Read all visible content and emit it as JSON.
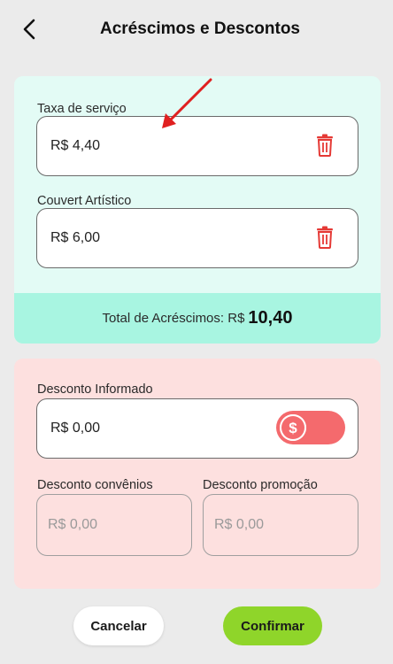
{
  "header": {
    "title": "Acréscimos e Descontos"
  },
  "acrescimos": {
    "taxa_label": "Taxa de serviço",
    "taxa_value": "R$ 4,40",
    "couvert_label": "Couvert Artístico",
    "couvert_value": "R$ 6,00",
    "total_label": "Total de Acréscimos: R$",
    "total_value": "10,40"
  },
  "descontos": {
    "informado_label": "Desconto Informado",
    "informado_value": "R$ 0,00",
    "convenios_label": "Desconto convênios",
    "convenios_placeholder": "R$ 0,00",
    "promocao_label": "Desconto promoção",
    "promocao_placeholder": "R$ 0,00"
  },
  "actions": {
    "cancel_label": "Cancelar",
    "confirm_label": "Confirmar"
  },
  "colors": {
    "accent_teal": "#a8f5e1",
    "accent_red": "#f46a6d",
    "confirm_green": "#8fd52a",
    "trash_red": "#e53935"
  },
  "icons": {
    "back": "chevron-left-icon",
    "trash": "trash-icon",
    "dollar": "dollar-icon",
    "annotation": "red-arrow-icon"
  }
}
